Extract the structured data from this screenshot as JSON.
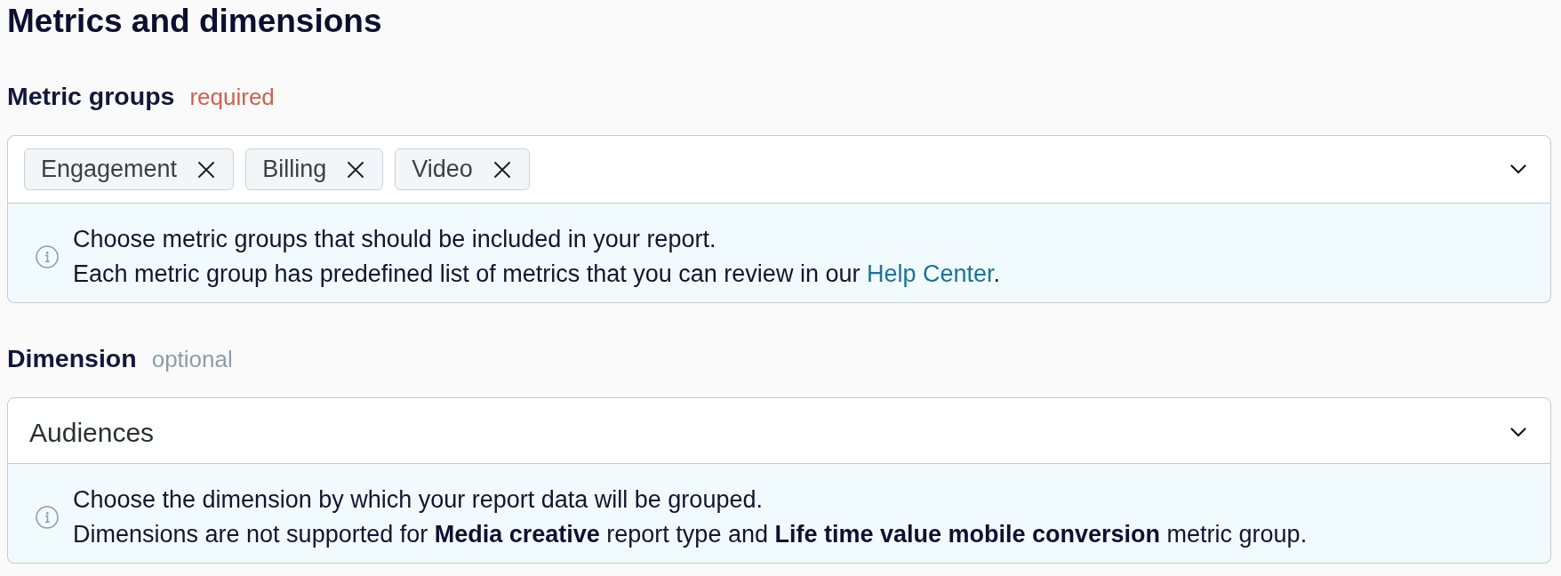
{
  "title": "Metrics and dimensions",
  "fields": [
    {
      "label": "Metric groups",
      "note": "required",
      "required": true,
      "kind": "multiselect",
      "chips": [
        "Engagement",
        "Billing",
        "Video"
      ],
      "help": [
        {
          "parts": [
            {
              "kind": "text",
              "text": "Choose metric groups that should be included in your report."
            }
          ]
        },
        {
          "parts": [
            {
              "kind": "text",
              "text": "Each metric group has predefined list of metrics that you can review in our "
            },
            {
              "kind": "link",
              "text": "Help Center"
            },
            {
              "kind": "text",
              "text": "."
            }
          ]
        }
      ]
    },
    {
      "label": "Dimension",
      "note": "optional",
      "required": false,
      "kind": "select",
      "value": "Audiences",
      "help": [
        {
          "parts": [
            {
              "kind": "text",
              "text": "Choose the dimension by which your report data will be grouped."
            }
          ]
        },
        {
          "parts": [
            {
              "kind": "text",
              "text": "Dimensions are not supported for **Media creative** report type and **Life time value mobile conversion** metric group."
            }
          ]
        }
      ]
    }
  ]
}
